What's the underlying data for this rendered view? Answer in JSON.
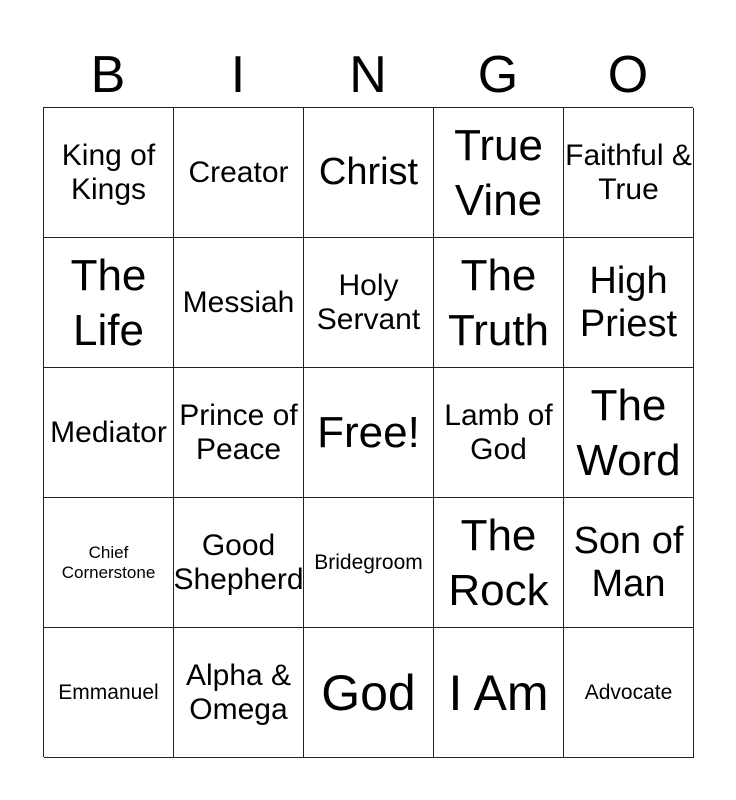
{
  "header": [
    "B",
    "I",
    "N",
    "G",
    "O"
  ],
  "cells": [
    {
      "text": "King of Kings",
      "size": "md"
    },
    {
      "text": "Creator",
      "size": "md"
    },
    {
      "text": "Christ",
      "size": "lg"
    },
    {
      "text": "True Vine",
      "size": "lg2"
    },
    {
      "text": "Faithful & True",
      "size": "md"
    },
    {
      "text": "The Life",
      "size": "lg2"
    },
    {
      "text": "Messiah",
      "size": "md"
    },
    {
      "text": "Holy Servant",
      "size": "md"
    },
    {
      "text": "The Truth",
      "size": "lg2"
    },
    {
      "text": "High Priest",
      "size": "lg"
    },
    {
      "text": "Mediator",
      "size": "md"
    },
    {
      "text": "Prince of Peace",
      "size": "md"
    },
    {
      "text": "Free!",
      "size": "lg2"
    },
    {
      "text": "Lamb of God",
      "size": "md"
    },
    {
      "text": "The Word",
      "size": "lg2"
    },
    {
      "text": "Chief Cornerstone",
      "size": "xs"
    },
    {
      "text": "Good Shepherd",
      "size": "md"
    },
    {
      "text": "Bridegroom",
      "size": "sm"
    },
    {
      "text": "The Rock",
      "size": "lg2"
    },
    {
      "text": "Son of Man",
      "size": "lg"
    },
    {
      "text": "Emmanuel",
      "size": "sm"
    },
    {
      "text": "Alpha & Omega",
      "size": "md"
    },
    {
      "text": "God",
      "size": "xl"
    },
    {
      "text": "I Am",
      "size": "xl"
    },
    {
      "text": "Advocate",
      "size": "sm"
    }
  ]
}
